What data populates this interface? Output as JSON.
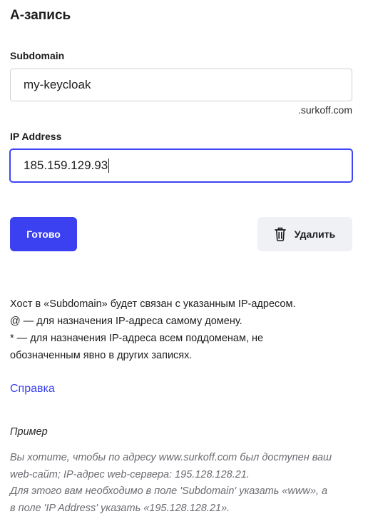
{
  "section_title": "А-запись",
  "subdomain": {
    "label": "Subdomain",
    "value": "my-keycloak",
    "suffix": ".surkoff.com"
  },
  "ip": {
    "label": "IP Address",
    "value": "185.159.129.93"
  },
  "buttons": {
    "done": "Готово",
    "delete": "Удалить",
    "delete_icon": "trash-icon"
  },
  "help": {
    "lines": [
      "Хост в «Subdomain» будет связан с указанным IP-адресом.",
      "@ — для назначения IP-адреса самому домену.",
      "* — для назначения IP-адреса всем поддоменам, не",
      "обозначенным явно в других записях."
    ],
    "link": "Справка"
  },
  "example": {
    "title": "Пример",
    "lines": [
      "Вы хотите, чтобы по адресу www.surkoff.com был доступен ваш",
      "web-сайт; IP-адрес web-сервера: 195.128.128.21.",
      "Для этого вам необходимо в поле 'Subdomain' указать «www», а",
      "в поле 'IP Address' указать «195.128.128.21»."
    ]
  },
  "colors": {
    "accent": "#3b40f0",
    "secondary_button_bg": "#f0f1f4",
    "muted_text": "#6b6b72"
  }
}
